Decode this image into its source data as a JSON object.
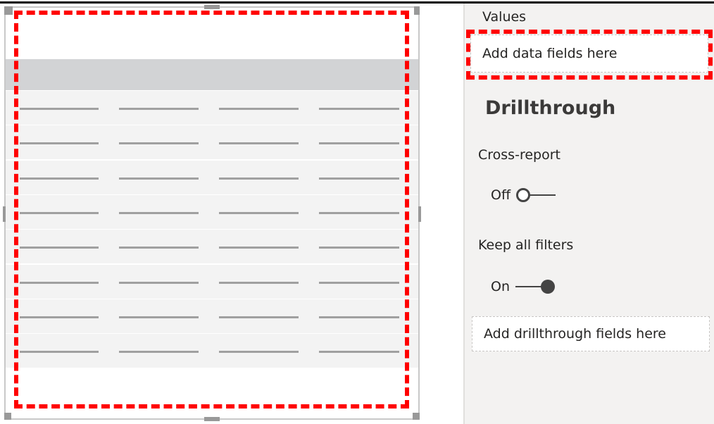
{
  "pane": {
    "values_label": "Values",
    "values_well_placeholder": "Add data fields here",
    "drillthrough_title": "Drillthrough",
    "cross_report": {
      "label": "Cross-report",
      "state": "Off"
    },
    "keep_all_filters": {
      "label": "Keep all filters",
      "state": "On"
    },
    "drillthrough_well_placeholder": "Add drillthrough fields here"
  },
  "colors": {
    "highlight": "#ff0000",
    "header": "#d2d3d5",
    "row": "#f3f3f3"
  }
}
